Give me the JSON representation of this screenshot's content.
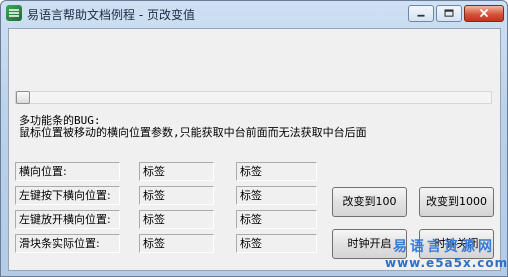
{
  "window": {
    "title": "易语言帮助文档例程 - 页改变值"
  },
  "note": {
    "line1": "多功能条的BUG:",
    "line2": "鼠标位置被移动的横向位置参数,只能获取中台前面而无法获取中台后面"
  },
  "rows": [
    {
      "label": "横向位置:",
      "value1": "标签",
      "value2": "标签"
    },
    {
      "label": "左键按下横向位置:",
      "value1": "标签",
      "value2": "标签"
    },
    {
      "label": "左键放开横向位置:",
      "value1": "标签",
      "value2": "标签"
    },
    {
      "label": "滑块条实际位置:",
      "value1": "标签",
      "value2": "标签"
    }
  ],
  "buttons": {
    "change_100": "改变到100",
    "change_1000": "改变到1000",
    "timer_on": "时钟开启",
    "timer_off": "时钟关闭"
  },
  "watermark": {
    "line1": "易语言资源网",
    "line2": "www.e5a5x.com"
  },
  "colors": {
    "titlebar": "#bcd2ea",
    "client_bg": "#f0f0f0",
    "watermark": "#3a7bd5"
  }
}
